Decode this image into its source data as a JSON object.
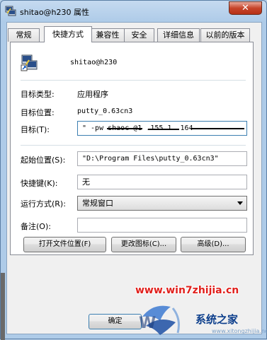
{
  "window": {
    "title": "shitao@h230 属性",
    "close_glyph": "✕"
  },
  "tabs": [
    {
      "label": "常规",
      "active": false
    },
    {
      "label": "快捷方式",
      "active": true
    },
    {
      "label": "兼容性",
      "active": false
    },
    {
      "label": "安全",
      "active": false
    },
    {
      "label": "详细信息",
      "active": false
    },
    {
      "label": "以前的版本",
      "active": false
    }
  ],
  "shortcut": {
    "name": "shitao@h230",
    "target_type_label": "目标类型:",
    "target_type_value": "应用程序",
    "target_location_label": "目标位置:",
    "target_location_value": "putty_0.63cn3",
    "target_label": "目标(T):",
    "target_value": "\" -pw shaoc           @1  .155.1  .164",
    "start_in_label": "起始位置(S):",
    "start_in_value": "\"D:\\Program Files\\putty_0.63cn3\"",
    "hotkey_label": "快捷键(K):",
    "hotkey_value": "无",
    "run_label": "运行方式(R):",
    "run_value": "常规窗口",
    "comment_label": "备注(O):",
    "comment_value": ""
  },
  "buttons": {
    "open_location": "打开文件位置(F)",
    "change_icon": "更改图标(C)...",
    "advanced": "高级(D)...",
    "ok": "确定"
  },
  "watermark": {
    "site": "www.win7zhijia.cn",
    "logo_brand": "系统之家",
    "logo_url": "www.xitongzhijia.net"
  },
  "colors": {
    "accent_blue": "#3c7fb1",
    "watermark_red": "#e0201c"
  }
}
